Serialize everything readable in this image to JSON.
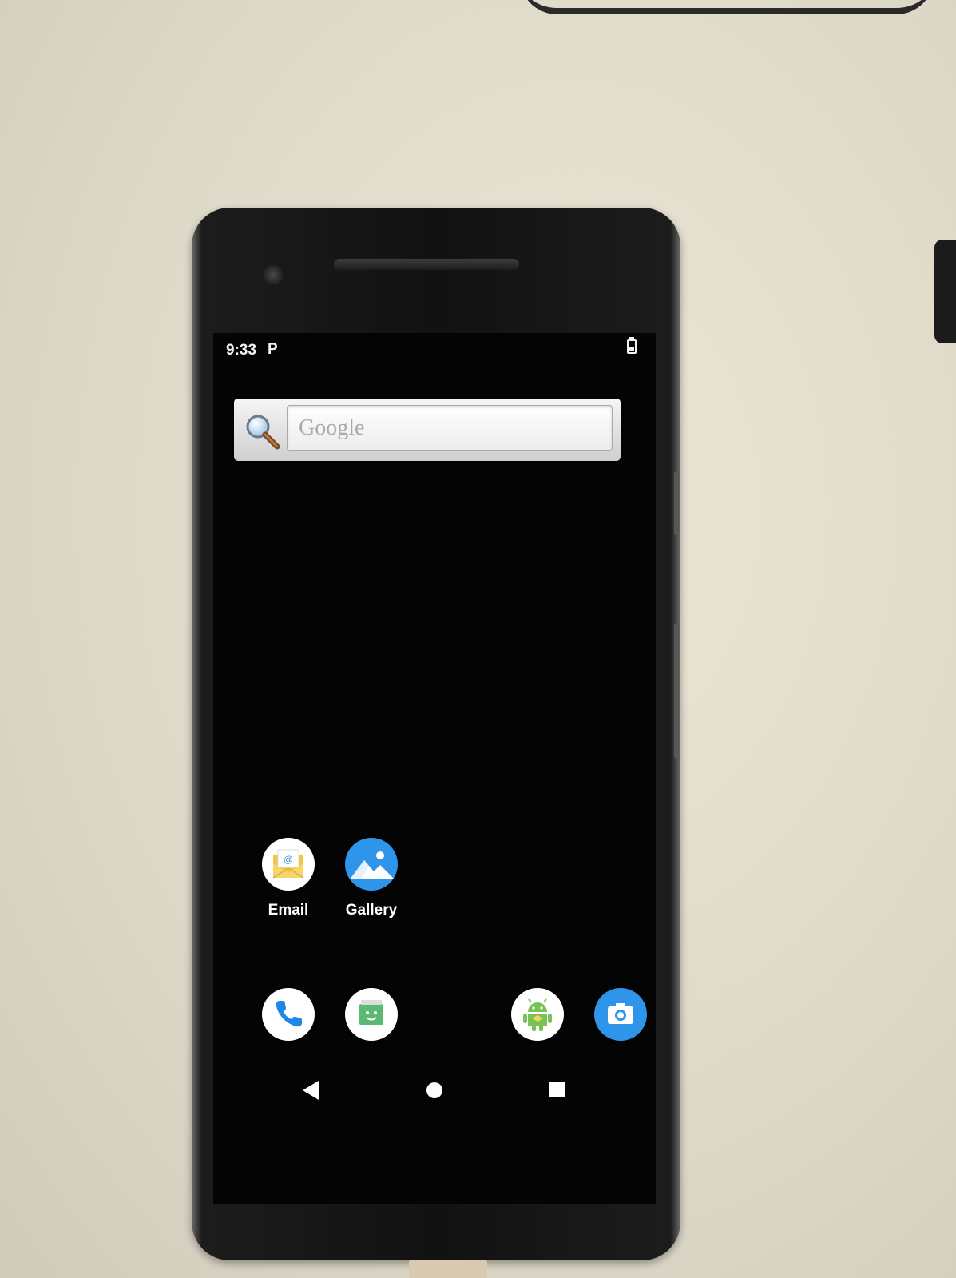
{
  "status_bar": {
    "time": "9:33",
    "notification_icon": "P",
    "battery": "battery-icon"
  },
  "search_widget": {
    "placeholder": "Google",
    "icon": "magnifier-icon"
  },
  "home_apps": [
    {
      "label": "Email",
      "icon": "email-icon"
    },
    {
      "label": "Gallery",
      "icon": "gallery-icon"
    }
  ],
  "dock": [
    {
      "icon": "phone-icon"
    },
    {
      "icon": "messaging-icon"
    },
    {
      "icon": "android-app-icon"
    },
    {
      "icon": "camera-icon"
    }
  ],
  "nav_bar": [
    "back-icon",
    "home-icon",
    "recents-icon"
  ],
  "colors": {
    "screen": "#040404",
    "gallery_blue": "#2f95ea",
    "camera_blue": "#2f95ea",
    "android_green": "#78c257",
    "phone_blue": "#1e88e5"
  }
}
